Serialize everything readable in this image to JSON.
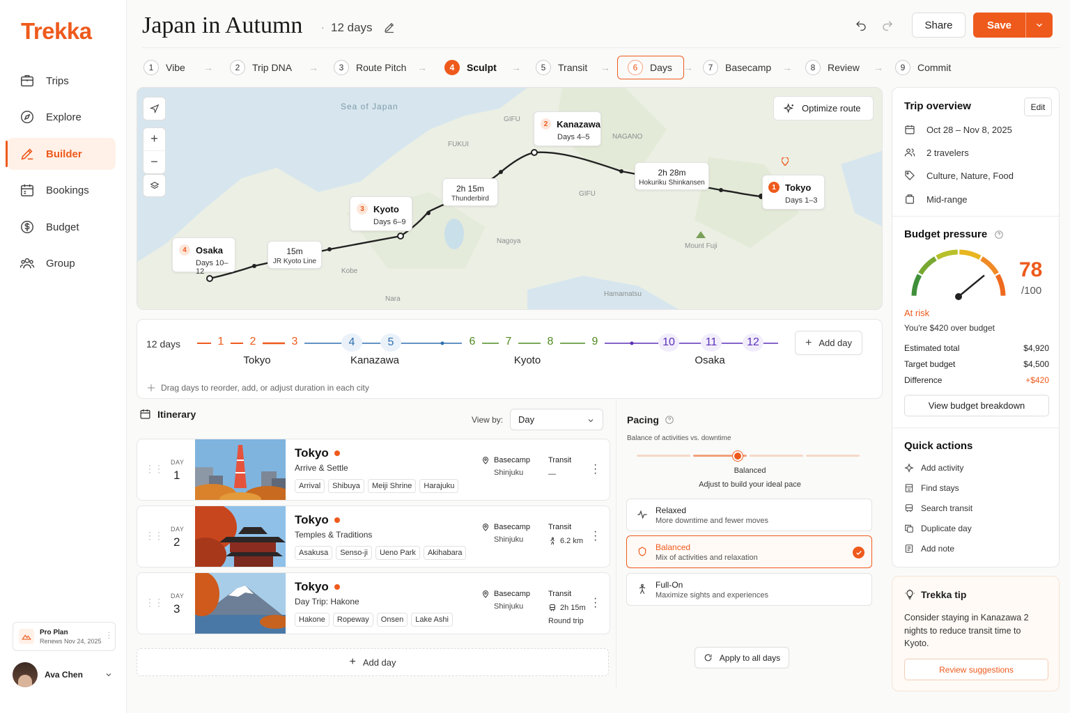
{
  "app": {
    "logo": "Trekka"
  },
  "sidebar": {
    "items": [
      {
        "label": "Trips",
        "icon": "suitcase-icon"
      },
      {
        "label": "Explore",
        "icon": "compass-icon"
      },
      {
        "label": "Builder",
        "icon": "pencil-icon",
        "active": true
      },
      {
        "label": "Bookings",
        "icon": "calendar-icon"
      },
      {
        "label": "Budget",
        "icon": "dollar-icon"
      },
      {
        "label": "Group",
        "icon": "users-icon"
      }
    ],
    "plan": {
      "name": "Pro Plan",
      "renews": "Renews Nov 24, 2025"
    },
    "user": {
      "name": "Ava Chen"
    }
  },
  "header": {
    "title": "Japan in Autumn",
    "meta": "12 days",
    "share": "Share",
    "save": "Save"
  },
  "steps": [
    {
      "n": "1",
      "label": "Vibe"
    },
    {
      "n": "2",
      "label": "Trip DNA"
    },
    {
      "n": "3",
      "label": "Route Pitch"
    },
    {
      "n": "4",
      "label": "Sculpt"
    },
    {
      "n": "5",
      "label": "Transit"
    },
    {
      "n": "6",
      "label": "Days"
    },
    {
      "n": "7",
      "label": "Basecamp"
    },
    {
      "n": "8",
      "label": "Review"
    },
    {
      "n": "9",
      "label": "Commit"
    }
  ],
  "map": {
    "optimize": "Optimize route",
    "stops": [
      {
        "n": "2",
        "city": "Kanazawa",
        "days": "Days 4–5"
      },
      {
        "n": "1",
        "city": "Tokyo",
        "days": "Days 1–3"
      },
      {
        "n": "3",
        "city": "Kyoto",
        "days": "Days 6–9"
      },
      {
        "n": "4",
        "city": "Osaka",
        "days": "Days 10–12"
      }
    ],
    "transits": [
      {
        "time": "2h 28m",
        "line": "Hokuriku Shinkansen"
      },
      {
        "time": "2h 15m",
        "line": "Thunderbird"
      },
      {
        "time": "15m",
        "line": "JR Kyoto Line"
      }
    ],
    "labels": {
      "sea": "Sea of Japan",
      "gifu": "GIFU",
      "fukui": "FUKUI",
      "nagano": "NAGANO",
      "gifu2": "GIFU",
      "nagoya": "Nagoya",
      "kobe": "Kobe",
      "nara": "Nara",
      "fuji": "Mount Fuji",
      "hamamatsu": "Hamamatsu"
    }
  },
  "timeline": {
    "label": "12 days",
    "days": [
      "1",
      "2",
      "3",
      "4",
      "5",
      "6",
      "7",
      "8",
      "9",
      "10",
      "11",
      "12"
    ],
    "cities": [
      "Tokyo",
      "Kanazawa",
      "Kyoto",
      "Osaka"
    ],
    "add": "Add day",
    "hint": "Drag days to reorder, add, or adjust duration in each city",
    "colors": {
      "tokyo": "#ee5a1c",
      "kanazawa": "#2f6fb0",
      "kyoto": "#4f8a22",
      "osaka": "#5a2fb8"
    }
  },
  "itinerary": {
    "title": "Itinerary",
    "viewby": "View by:",
    "select": "Day",
    "day_label": "DAY",
    "basecamp_label": "Basecamp",
    "transit_label": "Transit",
    "add": "Add day",
    "cards": [
      {
        "day": "1",
        "city": "Tokyo",
        "sub": "Arrive & Settle",
        "tags": [
          "Arrival",
          "Shibuya",
          "Meiji Shrine",
          "Harajuku"
        ],
        "basecamp": "Shinjuku",
        "transit": "—",
        "transit2": ""
      },
      {
        "day": "2",
        "city": "Tokyo",
        "sub": "Temples & Traditions",
        "tags": [
          "Asakusa",
          "Senso-ji",
          "Ueno Park",
          "Akihabara"
        ],
        "basecamp": "Shinjuku",
        "transit": "6.2 km",
        "transit2": ""
      },
      {
        "day": "3",
        "city": "Tokyo",
        "sub": "Day Trip: Hakone",
        "tags": [
          "Hakone",
          "Ropeway",
          "Onsen",
          "Lake Ashi"
        ],
        "basecamp": "Shinjuku",
        "transit": "2h 15m",
        "transit2": "Round trip"
      }
    ]
  },
  "pacing": {
    "title": "Pacing",
    "sub": "Balance of activities vs. downtime",
    "value": "Balanced",
    "hint": "Adjust to build your ideal pace",
    "options": [
      {
        "title": "Relaxed",
        "desc": "More downtime and fewer moves"
      },
      {
        "title": "Balanced",
        "desc": "Mix of activities and relaxation",
        "selected": true
      },
      {
        "title": "Full-On",
        "desc": "Maximize sights and experiences"
      }
    ],
    "apply": "Apply to all days"
  },
  "overview": {
    "title": "Trip overview",
    "edit": "Edit",
    "dates": "Oct 28 – Nov 8, 2025",
    "travelers": "2 travelers",
    "interests": "Culture, Nature, Food",
    "budget": "Mid-range"
  },
  "budget": {
    "title": "Budget pressure",
    "score": "78",
    "scale": "/100",
    "score_value": 78,
    "status": "At risk",
    "over": "You're $420 over budget",
    "rows": [
      {
        "k": "Estimated total",
        "v": "$4,920"
      },
      {
        "k": "Target budget",
        "v": "$4,500"
      },
      {
        "k": "Difference",
        "v": "+$420"
      }
    ],
    "view": "View budget breakdown"
  },
  "quick": {
    "title": "Quick actions",
    "items": [
      "Add activity",
      "Find stays",
      "Search transit",
      "Duplicate day",
      "Add note"
    ]
  },
  "tip": {
    "title": "Trekka tip",
    "body": "Consider staying in Kanazawa 2 nights to reduce transit time to Kyoto.",
    "button": "Review suggestions"
  }
}
